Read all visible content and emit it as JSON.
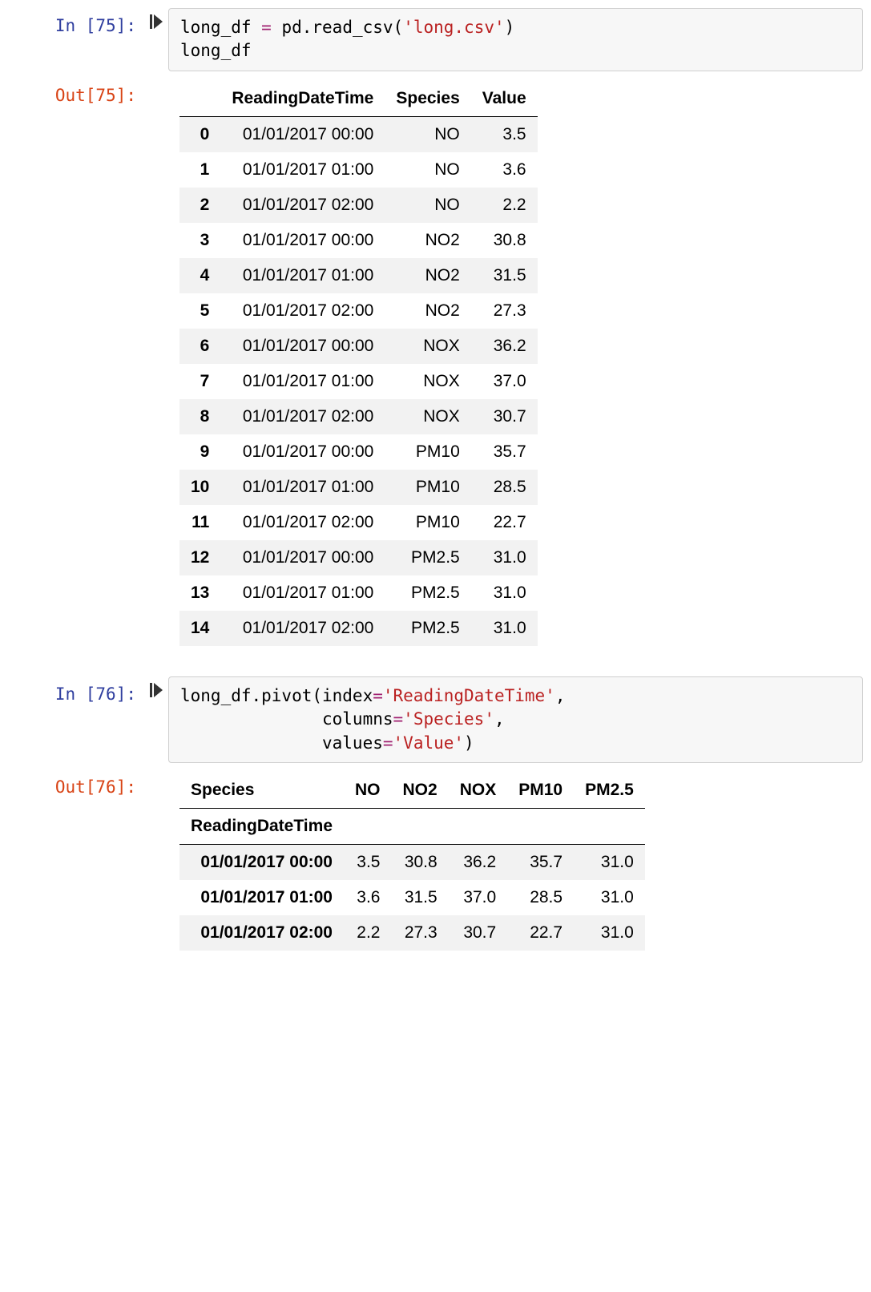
{
  "cell1": {
    "in_prompt": "In [75]:",
    "out_prompt": "Out[75]:",
    "code_var": "long_df ",
    "code_eq": "=",
    "code_call": " pd.read_csv(",
    "code_str": "'long.csv'",
    "code_close": ")",
    "code_line2": "long_df",
    "table": {
      "headers": [
        "ReadingDateTime",
        "Species",
        "Value"
      ],
      "rows": [
        {
          "idx": "0",
          "c0": "01/01/2017 00:00",
          "c1": "NO",
          "c2": "3.5"
        },
        {
          "idx": "1",
          "c0": "01/01/2017 01:00",
          "c1": "NO",
          "c2": "3.6"
        },
        {
          "idx": "2",
          "c0": "01/01/2017 02:00",
          "c1": "NO",
          "c2": "2.2"
        },
        {
          "idx": "3",
          "c0": "01/01/2017 00:00",
          "c1": "NO2",
          "c2": "30.8"
        },
        {
          "idx": "4",
          "c0": "01/01/2017 01:00",
          "c1": "NO2",
          "c2": "31.5"
        },
        {
          "idx": "5",
          "c0": "01/01/2017 02:00",
          "c1": "NO2",
          "c2": "27.3"
        },
        {
          "idx": "6",
          "c0": "01/01/2017 00:00",
          "c1": "NOX",
          "c2": "36.2"
        },
        {
          "idx": "7",
          "c0": "01/01/2017 01:00",
          "c1": "NOX",
          "c2": "37.0"
        },
        {
          "idx": "8",
          "c0": "01/01/2017 02:00",
          "c1": "NOX",
          "c2": "30.7"
        },
        {
          "idx": "9",
          "c0": "01/01/2017 00:00",
          "c1": "PM10",
          "c2": "35.7"
        },
        {
          "idx": "10",
          "c0": "01/01/2017 01:00",
          "c1": "PM10",
          "c2": "28.5"
        },
        {
          "idx": "11",
          "c0": "01/01/2017 02:00",
          "c1": "PM10",
          "c2": "22.7"
        },
        {
          "idx": "12",
          "c0": "01/01/2017 00:00",
          "c1": "PM2.5",
          "c2": "31.0"
        },
        {
          "idx": "13",
          "c0": "01/01/2017 01:00",
          "c1": "PM2.5",
          "c2": "31.0"
        },
        {
          "idx": "14",
          "c0": "01/01/2017 02:00",
          "c1": "PM2.5",
          "c2": "31.0"
        }
      ]
    }
  },
  "cell2": {
    "in_prompt": "In [76]:",
    "out_prompt": "Out[76]:",
    "code_l1a": "long_df.pivot(index",
    "code_eq1": "=",
    "code_s1": "'ReadingDateTime'",
    "code_l1c": ",",
    "code_l2a": "              columns",
    "code_eq2": "=",
    "code_s2": "'Species'",
    "code_l2c": ",",
    "code_l3a": "              values",
    "code_eq3": "=",
    "code_s3": "'Value'",
    "code_l3c": ")",
    "pivot": {
      "col_name": "Species",
      "columns": [
        "NO",
        "NO2",
        "NOX",
        "PM10",
        "PM2.5"
      ],
      "row_name": "ReadingDateTime",
      "rows": [
        {
          "idx": "01/01/2017 00:00",
          "v": [
            "3.5",
            "30.8",
            "36.2",
            "35.7",
            "31.0"
          ]
        },
        {
          "idx": "01/01/2017 01:00",
          "v": [
            "3.6",
            "31.5",
            "37.0",
            "28.5",
            "31.0"
          ]
        },
        {
          "idx": "01/01/2017 02:00",
          "v": [
            "2.2",
            "27.3",
            "30.7",
            "22.7",
            "31.0"
          ]
        }
      ]
    }
  }
}
